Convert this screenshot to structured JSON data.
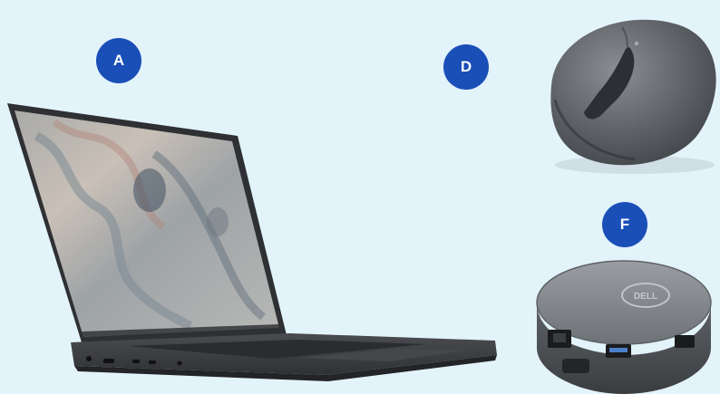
{
  "badges": {
    "a": "A",
    "d": "D",
    "f": "F"
  },
  "dock_logo": "DELL",
  "colors": {
    "background": "#e3f3fa",
    "badge": "#1a4fb8",
    "laptop_body": "#3b3d41",
    "mouse_body": "#5f6367",
    "dock_body": "#7d8185"
  },
  "items": [
    {
      "label": "A",
      "name": "laptop"
    },
    {
      "label": "D",
      "name": "wireless-mouse"
    },
    {
      "label": "F",
      "name": "usb-c-mobile-adapter"
    }
  ]
}
